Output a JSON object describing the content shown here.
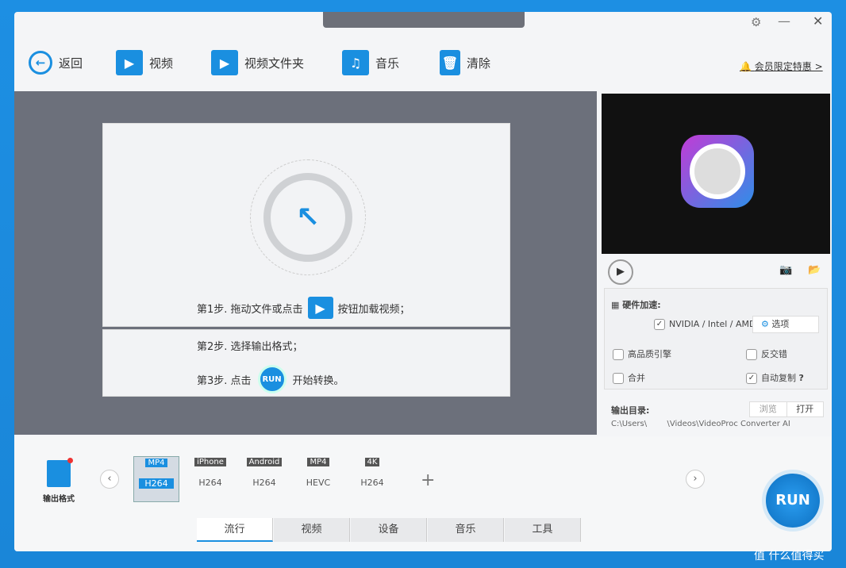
{
  "toolbar": {
    "back": "返回",
    "video": "视频",
    "video_folder": "视频文件夹",
    "music": "音乐",
    "clear": "清除",
    "promo": "会员限定特惠 >"
  },
  "steps": {
    "step1_a": "第1步. 拖动文件或点击",
    "step1_b": "按钮加载视频；",
    "step2": "第2步. 选择输出格式；",
    "step3_a": "第3步. 点击",
    "step3_b": "开始转换。",
    "run_small": "RUN"
  },
  "options": {
    "hw_accel": "硬件加速:",
    "gpu": "NVIDIA / Intel / AMD",
    "gpu_checked": true,
    "settings": "选项",
    "hq_engine": "高品质引擎",
    "hq_engine_checked": false,
    "deinterlace": "反交错",
    "deinterlace_checked": false,
    "merge": "合并",
    "merge_checked": false,
    "auto_copy": "自动复制",
    "auto_copy_checked": true,
    "help": "?"
  },
  "output": {
    "label": "输出目录:",
    "browse": "浏览",
    "open": "打开",
    "path": "C:\\Users\\        \\Videos\\VideoProc Converter AI"
  },
  "formats": {
    "label": "输出格式",
    "items": [
      {
        "top": "MP4",
        "bottom": "H264",
        "selected": true
      },
      {
        "top": "iPhone",
        "bottom": "H264"
      },
      {
        "top": "Android",
        "bottom": "H264"
      },
      {
        "top": "MP4",
        "bottom": "HEVC"
      },
      {
        "top": "4K",
        "bottom": "H264"
      }
    ]
  },
  "tabs": [
    "流行",
    "视频",
    "设备",
    "音乐",
    "工具"
  ],
  "run": "RUN",
  "watermark": "值 什么值得买",
  "colors": {
    "accent": "#1a8fe0",
    "promo": "#f06a20"
  }
}
